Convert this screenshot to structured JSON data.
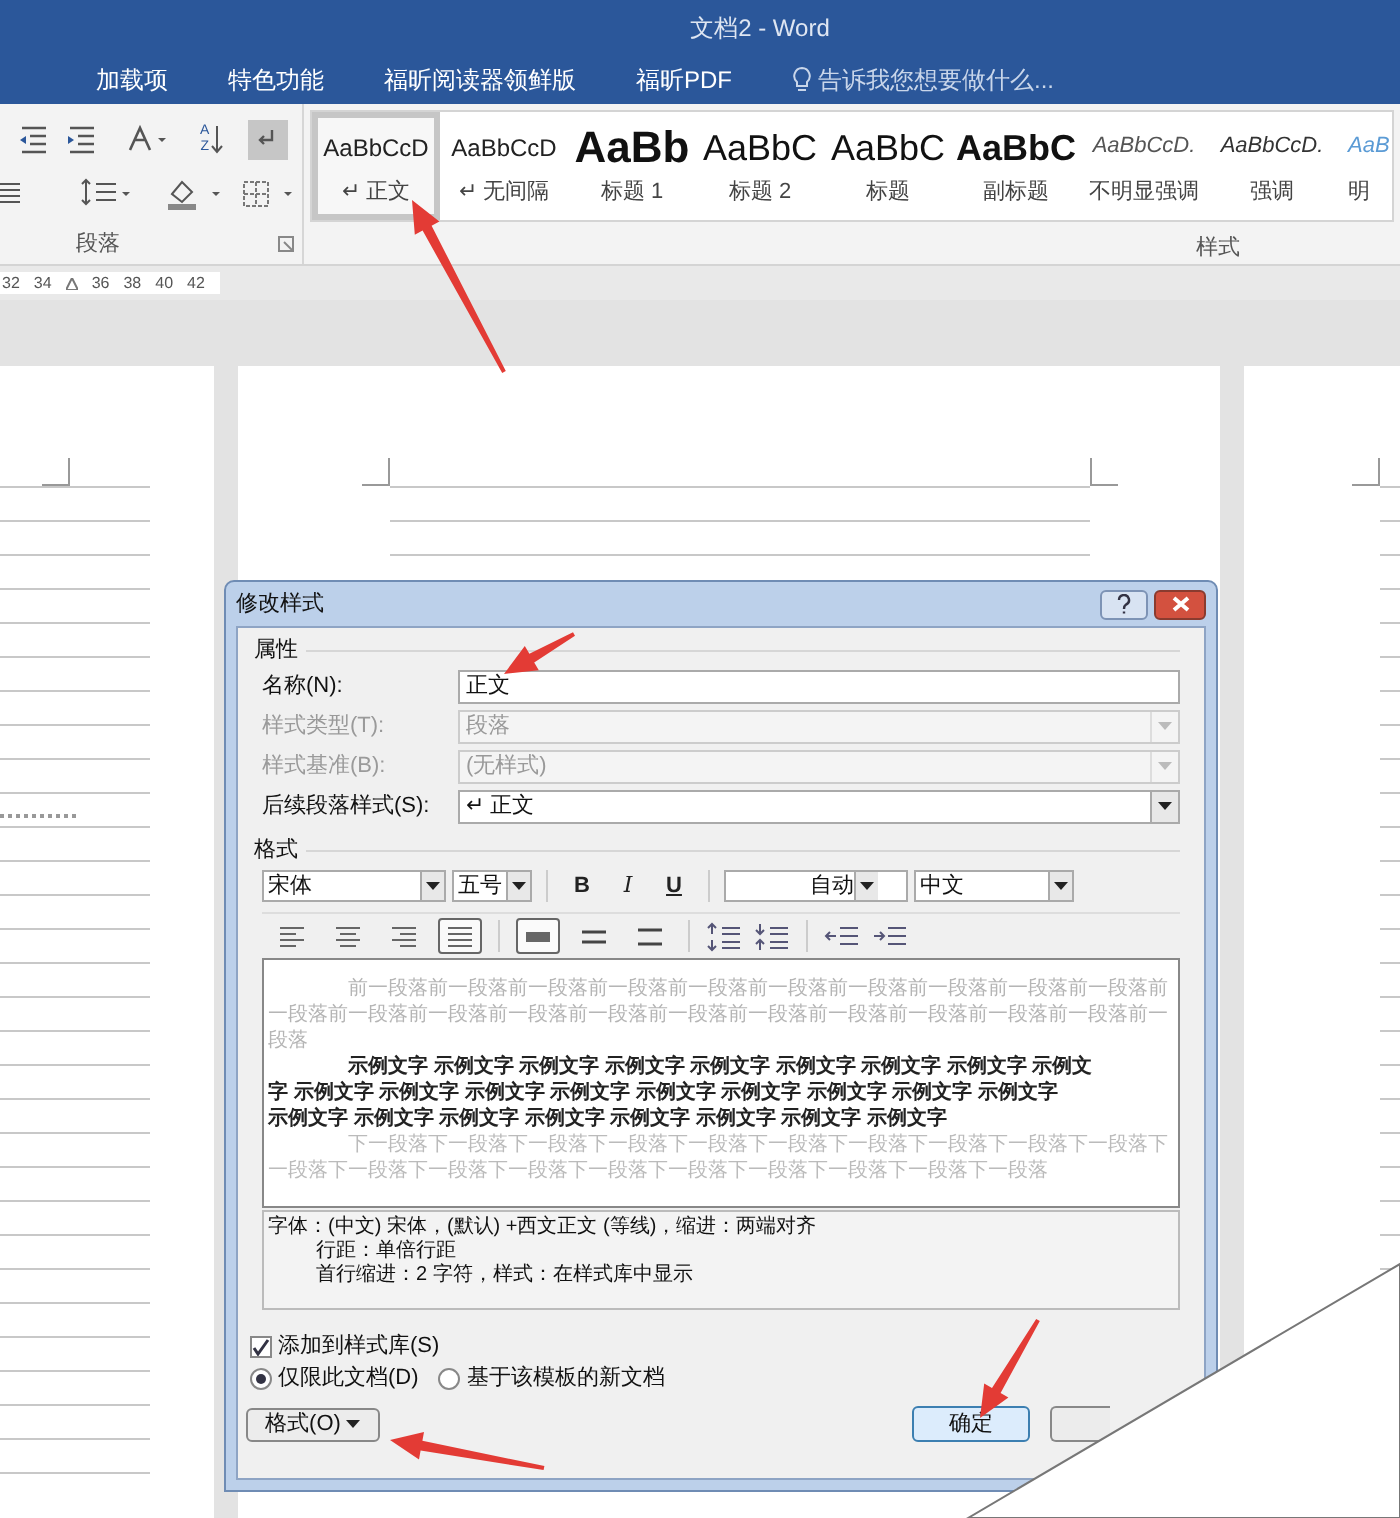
{
  "window": {
    "title": "文档2 - Word"
  },
  "ribbon_tabs": [
    {
      "label": "加载项"
    },
    {
      "label": "特色功能"
    },
    {
      "label": "福昕阅读器领鲜版"
    },
    {
      "label": "福昕PDF"
    }
  ],
  "tell_me": {
    "placeholder": "告诉我您想要做什么..."
  },
  "ribbon_groups": [
    {
      "label": "段落"
    },
    {
      "label": "样式"
    }
  ],
  "styles_gallery": [
    {
      "preview": "AaBbCcD",
      "label": "↵ 正文",
      "kind": "body",
      "selected": true
    },
    {
      "preview": "AaBbCcD",
      "label": "↵ 无间隔",
      "kind": "body",
      "selected": false
    },
    {
      "preview": "AaBb",
      "label": "标题 1",
      "kind": "heading1",
      "selected": false
    },
    {
      "preview": "AaBbC",
      "label": "标题 2",
      "kind": "heading2",
      "selected": false
    },
    {
      "preview": "AaBbC",
      "label": "标题",
      "kind": "heading2",
      "selected": false
    },
    {
      "preview": "AaBbC",
      "label": "副标题",
      "kind": "title",
      "selected": false
    },
    {
      "preview": "AaBbCcD.",
      "label": "不明显强调",
      "kind": "subtle",
      "selected": false
    },
    {
      "preview": "AaBbCcD.",
      "label": "强调",
      "kind": "emphasis",
      "selected": false
    },
    {
      "preview": "AaB",
      "label": "明",
      "kind": "intense",
      "selected": false
    }
  ],
  "sort_button": {
    "top": "A",
    "bottom": "Z"
  },
  "ruler": [
    "32",
    "34",
    "36",
    "38",
    "40",
    "42"
  ],
  "dialog": {
    "title": "修改样式",
    "properties_heading": "属性",
    "fields": [
      {
        "label": "名称(N):",
        "value": "正文",
        "kind": "text",
        "disabled": false
      },
      {
        "label": "样式类型(T):",
        "value": "段落",
        "kind": "select",
        "disabled": true
      },
      {
        "label": "样式基准(B):",
        "value": "(无样式)",
        "kind": "select",
        "disabled": true
      },
      {
        "label": "后续段落样式(S):",
        "value": "↵ 正文",
        "kind": "select",
        "disabled": false
      }
    ],
    "format_heading": "格式",
    "font": "宋体",
    "size": "五号",
    "format_buttons": [
      "B",
      "I",
      "U"
    ],
    "font_color": "自动",
    "script": "中文",
    "align_buttons": [
      {
        "kind": "left",
        "selected": false
      },
      {
        "kind": "center",
        "selected": false
      },
      {
        "kind": "right",
        "selected": false
      },
      {
        "kind": "justify",
        "selected": true
      }
    ],
    "spacing_buttons": [
      {
        "kind": "single",
        "selected": true
      },
      {
        "kind": "onehalf",
        "selected": false
      },
      {
        "kind": "double",
        "selected": false
      }
    ],
    "preview": {
      "previous": "前一段落前一段落前一段落前一段落前一段落前一段落前一段落前一段落前一段落前一段落前一段落前一段落前一段落前一段落前一段落前一段落前一段落前一段落前一段落前一段落前一段落前一段落",
      "sample_lines": [
        "示例文字 示例文字 示例文字 示例文字 示例文字 示例文字 示例文字 示例文字 示例文",
        "字 示例文字 示例文字 示例文字 示例文字 示例文字 示例文字 示例文字 示例文字 示例文字",
        "示例文字 示例文字 示例文字 示例文字 示例文字 示例文字 示例文字 示例文字"
      ],
      "next": "下一段落下一段落下一段落下一段落下一段落下一段落下一段落下一段落下一段落下一段落下一段落下一段落下一段落下一段落下一段落下一段落下一段落下一段落下一段落下一段落"
    },
    "description": [
      "字体：(中文) 宋体，(默认) +西文正文 (等线)，缩进：两端对齐",
      "行距：单倍行距",
      "首行缩进：2 字符，样式：在样式库中显示"
    ],
    "add_to_gallery": {
      "label": "添加到样式库(S)",
      "checked": true
    },
    "scope": [
      {
        "label": "仅限此文档(D)",
        "selected": true
      },
      {
        "label": "基于该模板的新文档",
        "selected": false
      }
    ],
    "format_menu": "格式(O)",
    "ok": "确定"
  }
}
